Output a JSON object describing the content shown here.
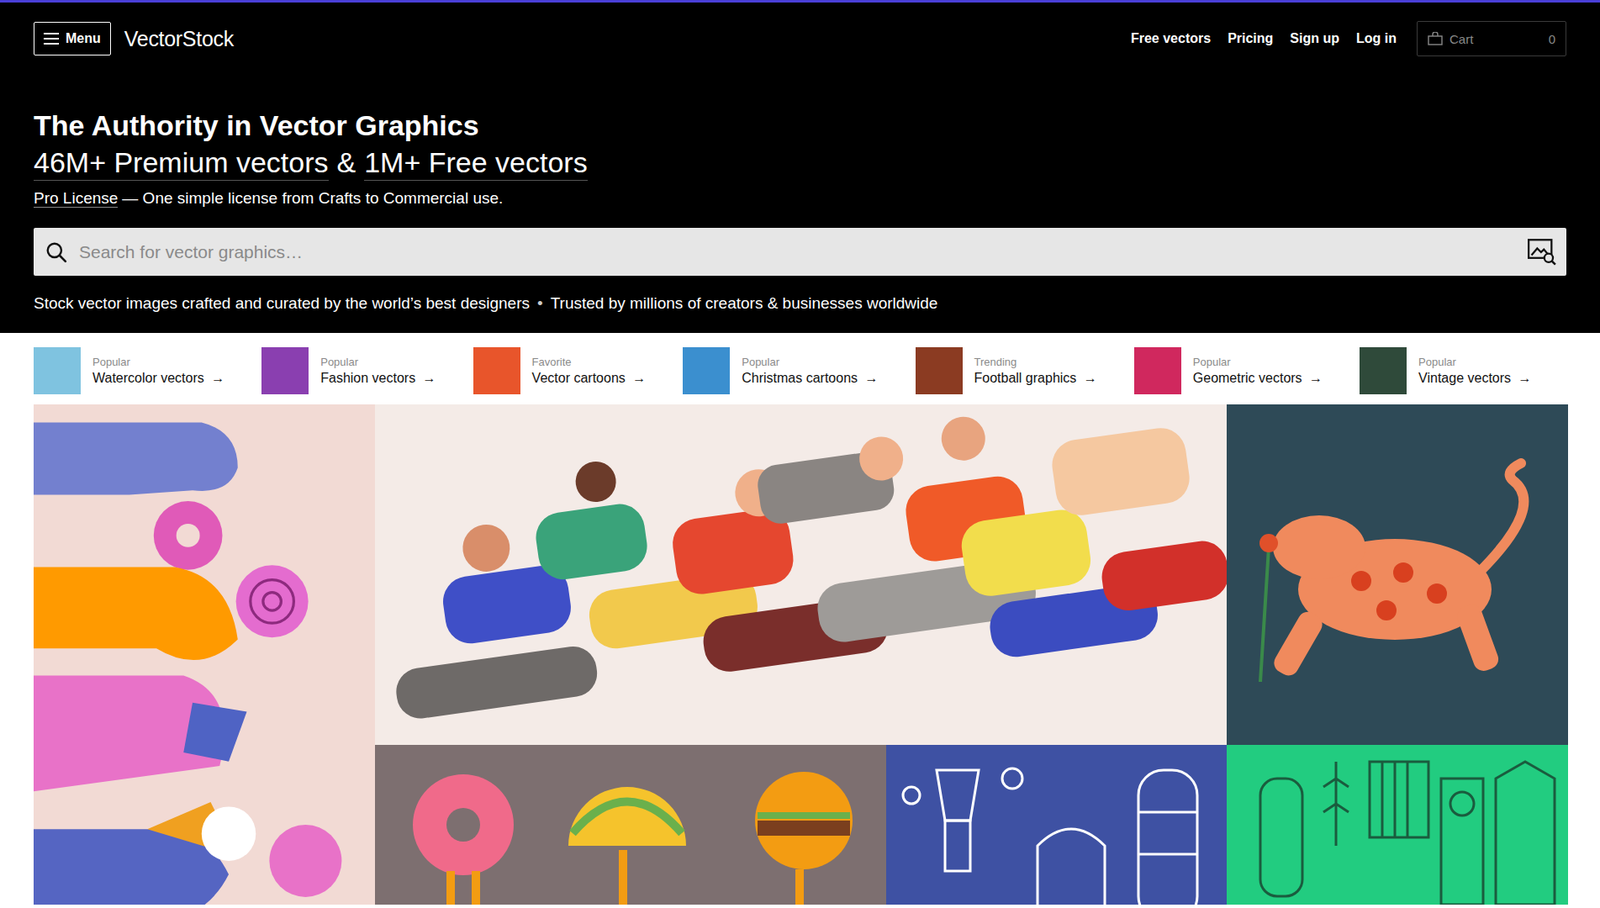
{
  "header": {
    "menu_button": "Menu",
    "logo": "VectorStock",
    "nav_links": [
      "Free vectors",
      "Pricing",
      "Sign up",
      "Log in"
    ],
    "cart": {
      "label": "Cart",
      "count": "0"
    }
  },
  "hero": {
    "title": "The Authority in Vector Graphics",
    "subtitle": {
      "premium": "46M+ Premium vectors",
      "joiner": "&",
      "free": "1M+ Free vectors"
    },
    "license": {
      "link": "Pro License",
      "text": "— One simple license from Crafts to Commercial use."
    },
    "search": {
      "placeholder": "Search for vector graphics…"
    },
    "taglines": [
      "Stock vector images crafted and curated by the world’s best designers",
      "Trusted by millions of creators & businesses worldwide"
    ],
    "separator": "•"
  },
  "category_arrow": "→",
  "categories": [
    {
      "tag": "Popular",
      "label": "Watercolor vectors",
      "color": "#7fc3e0"
    },
    {
      "tag": "Popular",
      "label": "Fashion vectors",
      "color": "#8a3fb0"
    },
    {
      "tag": "Favorite",
      "label": "Vector cartoons",
      "color": "#e8552b"
    },
    {
      "tag": "Popular",
      "label": "Christmas cartoons",
      "color": "#3b8fcf"
    },
    {
      "tag": "Trending",
      "label": "Football graphics",
      "color": "#8b3b22"
    },
    {
      "tag": "Popular",
      "label": "Geometric vectors",
      "color": "#d0285e"
    },
    {
      "tag": "Popular",
      "label": "Vintage vectors",
      "color": "#2f4a3a"
    }
  ],
  "gallery": [
    {
      "kind": "sweets",
      "color": "#f2dad4"
    },
    {
      "kind": "runners",
      "color": "#f4ebe7"
    },
    {
      "kind": "tiger",
      "color": "#2e4a57"
    },
    {
      "kind": "food",
      "color": "#7d6f70"
    },
    {
      "kind": "brewery-blue",
      "color": "#3e51a3"
    },
    {
      "kind": "brewery-green",
      "color": "#22cc80"
    }
  ]
}
